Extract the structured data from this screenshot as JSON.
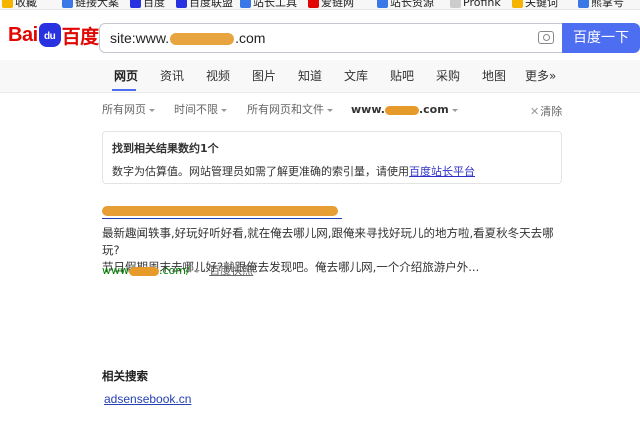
{
  "bookmarks": [
    {
      "label": "收藏",
      "color": "#f4b400"
    },
    {
      "label": "链接大案",
      "color": "#3b78e7"
    },
    {
      "label": "百度",
      "color": "#2932e1"
    },
    {
      "label": "百度联盟",
      "color": "#2932e1"
    },
    {
      "label": "站长工具",
      "color": "#3b78e7"
    },
    {
      "label": "爱链网",
      "color": "#e10601"
    },
    {
      "label": "站长资源",
      "color": "#3b78e7"
    },
    {
      "label": "Profink",
      "color": "#cccccc"
    },
    {
      "label": "关键词",
      "color": "#f4b400"
    },
    {
      "label": "熊掌号",
      "color": "#3b78e7"
    }
  ],
  "logo": {
    "part1": "Bai",
    "paw": "du",
    "part2": "百度"
  },
  "search": {
    "prefix": "site:www.",
    "suffix": ".com",
    "button": "百度一下"
  },
  "tabs": [
    "网页",
    "资讯",
    "视频",
    "图片",
    "知道",
    "文库",
    "贴吧",
    "采购",
    "地图",
    "更多»"
  ],
  "filters": {
    "pages": "所有网页",
    "time": "时间不限",
    "filetype": "所有网页和文件",
    "site_prefix": "www.",
    "site_suffix": ".com",
    "clear": "清除"
  },
  "stats": {
    "title": "找到相关结果数约1个",
    "desc": "数字为估算值。网站管理员如需了解更准确的索引量，请使用",
    "link": "百度站长平台"
  },
  "result": {
    "snippet_line1": "最新趣闻轶事,好玩好听好看,就在俺去哪儿网,跟俺来寻找好玩儿的地方啦,看夏秋冬天去哪玩?",
    "snippet_line2": "节日假期周末去哪儿好?就跟俺去发现吧。俺去哪儿网,一个介绍旅游户外...",
    "url_prefix": "www",
    "url_suffix": ".com/",
    "sep": "-",
    "kuaizhao": "百度快照"
  },
  "related": {
    "title": "相关搜索",
    "link": "adsensebook.cn"
  }
}
